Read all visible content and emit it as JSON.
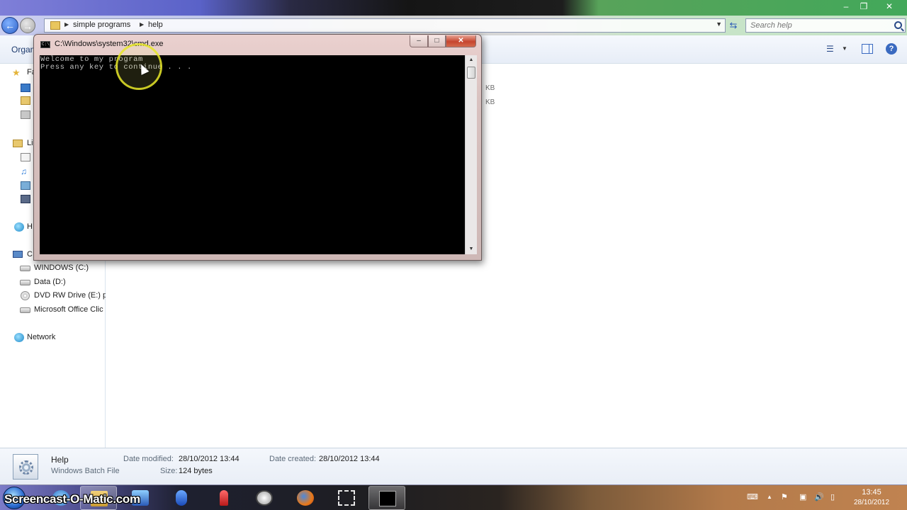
{
  "explorer": {
    "breadcrumb": [
      "simple programs",
      "help"
    ],
    "search_placeholder": "Search help",
    "toolbar": {
      "organize_label": "Organ"
    },
    "nav_pane": {
      "fav_label": "Fa",
      "lib_label": "Li",
      "home_label": "H",
      "comp_label": "C",
      "drives": [
        "WINDOWS (C:)",
        "Data (D:)",
        "DVD RW Drive (E:) pu",
        "Microsoft Office Clic"
      ],
      "network_label": "Network"
    },
    "file_area": {
      "size_fragments": [
        "KB",
        "KB"
      ]
    },
    "details": {
      "file_name": "Help",
      "file_type": "Windows Batch File",
      "date_modified_label": "Date modified:",
      "date_modified_value": "28/10/2012 13:44",
      "date_created_label": "Date created:",
      "date_created_value": "28/10/2012 13:44",
      "size_label": "Size:",
      "size_value": "124 bytes"
    }
  },
  "cmd": {
    "title": "C:\\Windows\\system32\\cmd.exe",
    "lines": [
      "Welcome to my program",
      "Press any key to continue . . ."
    ]
  },
  "taskbar": {
    "watermark": "Screencast-O-Matic.com",
    "time": "13:45",
    "date": "28/10/2012"
  }
}
